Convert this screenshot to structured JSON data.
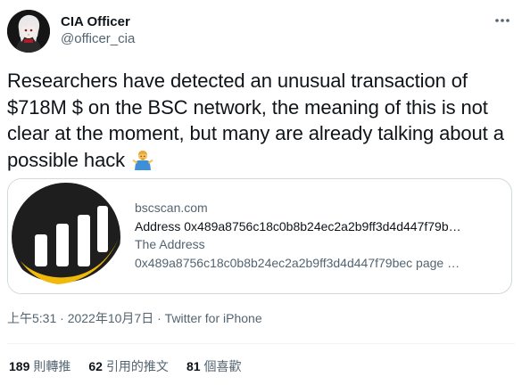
{
  "author": {
    "display_name": "CIA Officer",
    "handle": "@officer_cia"
  },
  "tweet": {
    "text": "Researchers have detected an unusual transaction of $718M $ on the BSC network, the meaning of this is not clear at the moment, but many are already talking about a possible hack",
    "emoji_icon": "person-shrugging-icon"
  },
  "card": {
    "domain": "bscscan.com",
    "title": "Address 0x489a8756c18c0b8b24ec2a2b9ff3d4d447f79b…",
    "subtitle": "The Address",
    "description": "0x489a8756c18c0b8b24ec2a2b9ff3d4d447f79bec page …",
    "brand_colors": {
      "dark": "#1e1e1e",
      "gold": "#f0b90b"
    }
  },
  "meta": {
    "time": "上午5:31",
    "separator": "·",
    "date": "2022年10月7日",
    "source": "Twitter for iPhone"
  },
  "stats": {
    "retweets_count": "189",
    "retweets_label": "則轉推",
    "quotes_count": "62",
    "quotes_label": "引用的推文",
    "likes_count": "81",
    "likes_label": "個喜歡"
  },
  "colors": {
    "text_primary": "#0f1419",
    "text_secondary": "#536471",
    "border": "#cfd9de"
  }
}
